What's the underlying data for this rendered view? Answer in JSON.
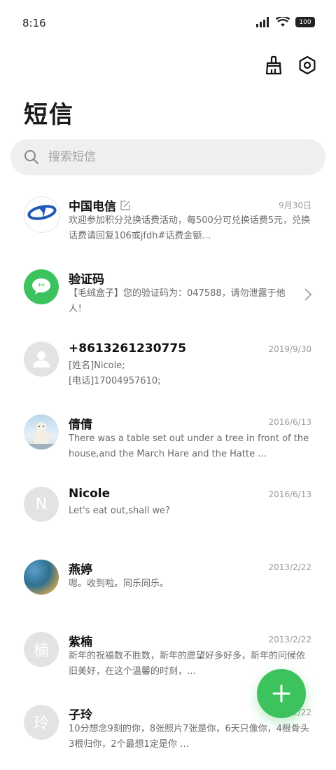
{
  "status_bar": {
    "time": "8:16",
    "battery": "100"
  },
  "header": {
    "title": "短信"
  },
  "search": {
    "placeholder": "搜索短信"
  },
  "messages": [
    {
      "name": "中国电信",
      "date": "9月30日",
      "preview": "欢迎参加积分兑换话费活动，每500分可兑换话费5元，兑换话费请回复106或jfdh#话费金额…",
      "avatar": "telecom-logo"
    },
    {
      "name": "验证码",
      "date": "",
      "preview": "【毛绒盒子】您的验证码为：047588，请勿泄露于他人！",
      "avatar": "chat-bubble"
    },
    {
      "name": "+8613261230775",
      "date": "2019/9/30",
      "preview": "[姓名]Nicole;\n[电话]17004957610;",
      "avatar": "person"
    },
    {
      "name": "倩倩",
      "date": "2016/6/13",
      "preview": "There was a table set out under a tree in front of the house,and the March Hare and the Hatte …",
      "avatar": "photo-bear"
    },
    {
      "name": "Nicole",
      "date": "2016/6/13",
      "preview": "Let's eat out,shall we?",
      "avatar": "N"
    },
    {
      "name": "燕婷",
      "date": "2013/2/22",
      "preview": "嗯。收到啦。同乐同乐。",
      "avatar": "photo-landscape"
    },
    {
      "name": "紫楠",
      "date": "2013/2/22",
      "preview": "新年的祝福数不胜数，新年的愿望好多好多，新年的问候依旧美好，在这个温馨的时刻，…",
      "avatar": "楠"
    },
    {
      "name": "子玲",
      "date": "2013/2/22",
      "preview": "10分想念9刻的你，8张照片7张是你，6天只像你，4根骨头3根归你，2个最想1定是你 …",
      "avatar": "玲"
    }
  ],
  "colors": {
    "accent": "#3cc35e",
    "telecom_blue": "#1f5bb5"
  },
  "icons": [
    "signal-icon",
    "wifi-icon",
    "battery-icon",
    "clean-icon",
    "settings-icon",
    "search-icon",
    "edit-icon",
    "chevron-right-icon",
    "add-icon"
  ]
}
